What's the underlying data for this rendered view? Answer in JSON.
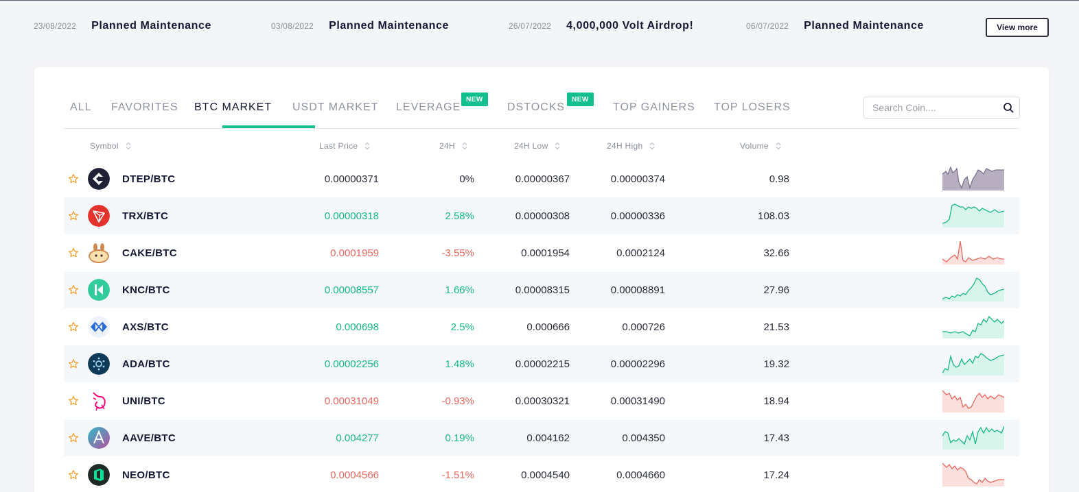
{
  "announcements": [
    {
      "date": "23/08/2022",
      "title": "Planned Maintenance"
    },
    {
      "date": "03/08/2022",
      "title": "Planned Maintenance"
    },
    {
      "date": "26/07/2022",
      "title": "4,000,000 Volt Airdrop!"
    },
    {
      "date": "06/07/2022",
      "title": "Planned Maintenance"
    }
  ],
  "view_more_label": "View more",
  "tabs": [
    {
      "label": "ALL",
      "active": false
    },
    {
      "label": "FAVORITES",
      "active": false
    },
    {
      "label": "BTC MARKET",
      "active": true
    },
    {
      "label": "USDT MARKET",
      "active": false
    },
    {
      "label": "LEVERAGE",
      "active": false,
      "badge": "NEW"
    },
    {
      "label": "DSTOCKS",
      "active": false,
      "badge": "NEW"
    },
    {
      "label": "TOP GAINERS",
      "active": false
    },
    {
      "label": "TOP LOSERS",
      "active": false
    }
  ],
  "search": {
    "placeholder": "Search Coin....",
    "value": ""
  },
  "table": {
    "headers": {
      "symbol": "Symbol",
      "last_price": "Last Price",
      "change": "24H",
      "low": "24H Low",
      "high": "24H High",
      "volume": "Volume"
    },
    "rows": [
      {
        "symbol": "DTEP/BTC",
        "price": "0.00000371",
        "change": "0%",
        "low": "0.00000367",
        "high": "0.00000374",
        "volume": "0.98",
        "trend": "flat",
        "icon": "dtep-icon"
      },
      {
        "symbol": "TRX/BTC",
        "price": "0.00000318",
        "change": "2.58%",
        "low": "0.00000308",
        "high": "0.00000336",
        "volume": "108.03",
        "trend": "up",
        "icon": "trx-icon"
      },
      {
        "symbol": "CAKE/BTC",
        "price": "0.0001959",
        "change": "-3.55%",
        "low": "0.0001954",
        "high": "0.0002124",
        "volume": "32.66",
        "trend": "down",
        "icon": "cake-icon"
      },
      {
        "symbol": "KNC/BTC",
        "price": "0.00008557",
        "change": "1.66%",
        "low": "0.00008315",
        "high": "0.00008891",
        "volume": "27.96",
        "trend": "up",
        "icon": "knc-icon"
      },
      {
        "symbol": "AXS/BTC",
        "price": "0.000698",
        "change": "2.5%",
        "low": "0.000666",
        "high": "0.000726",
        "volume": "21.53",
        "trend": "up",
        "icon": "axs-icon"
      },
      {
        "symbol": "ADA/BTC",
        "price": "0.00002256",
        "change": "1.48%",
        "low": "0.00002215",
        "high": "0.00002296",
        "volume": "19.32",
        "trend": "up",
        "icon": "ada-icon"
      },
      {
        "symbol": "UNI/BTC",
        "price": "0.00031049",
        "change": "-0.93%",
        "low": "0.00030321",
        "high": "0.00031490",
        "volume": "18.94",
        "trend": "down",
        "icon": "uni-icon"
      },
      {
        "symbol": "AAVE/BTC",
        "price": "0.004277",
        "change": "0.19%",
        "low": "0.004162",
        "high": "0.004350",
        "volume": "17.43",
        "trend": "up",
        "icon": "aave-icon"
      },
      {
        "symbol": "NEO/BTC",
        "price": "0.0004566",
        "change": "-1.51%",
        "low": "0.0004540",
        "high": "0.0004660",
        "volume": "17.24",
        "trend": "down",
        "icon": "neo-icon"
      }
    ]
  },
  "colors": {
    "accent": "#12c08f",
    "up": "#17b985",
    "down": "#e5675e",
    "flat": "#7d7390"
  }
}
